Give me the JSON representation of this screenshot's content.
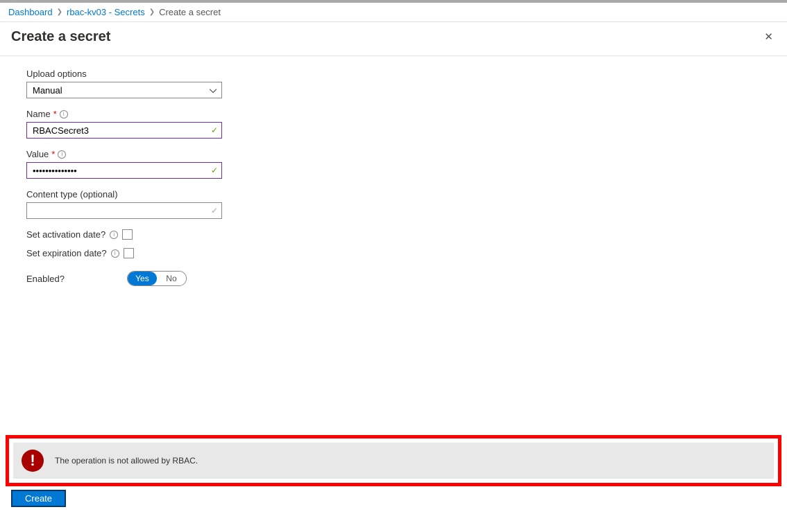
{
  "breadcrumb": {
    "items": [
      "Dashboard",
      "rbac-kv03 - Secrets"
    ],
    "current": "Create a secret"
  },
  "header": {
    "title": "Create a secret"
  },
  "form": {
    "upload_label": "Upload options",
    "upload_value": "Manual",
    "name_label": "Name",
    "name_value": "RBACSecret3",
    "value_label": "Value",
    "value_value": "••••••••••••••",
    "content_type_label": "Content type (optional)",
    "content_type_value": "",
    "activation_label": "Set activation date?",
    "expiration_label": "Set expiration date?",
    "enabled_label": "Enabled?",
    "toggle_yes": "Yes",
    "toggle_no": "No"
  },
  "error": {
    "message": "The operation is not allowed by RBAC."
  },
  "footer": {
    "create_label": "Create"
  }
}
